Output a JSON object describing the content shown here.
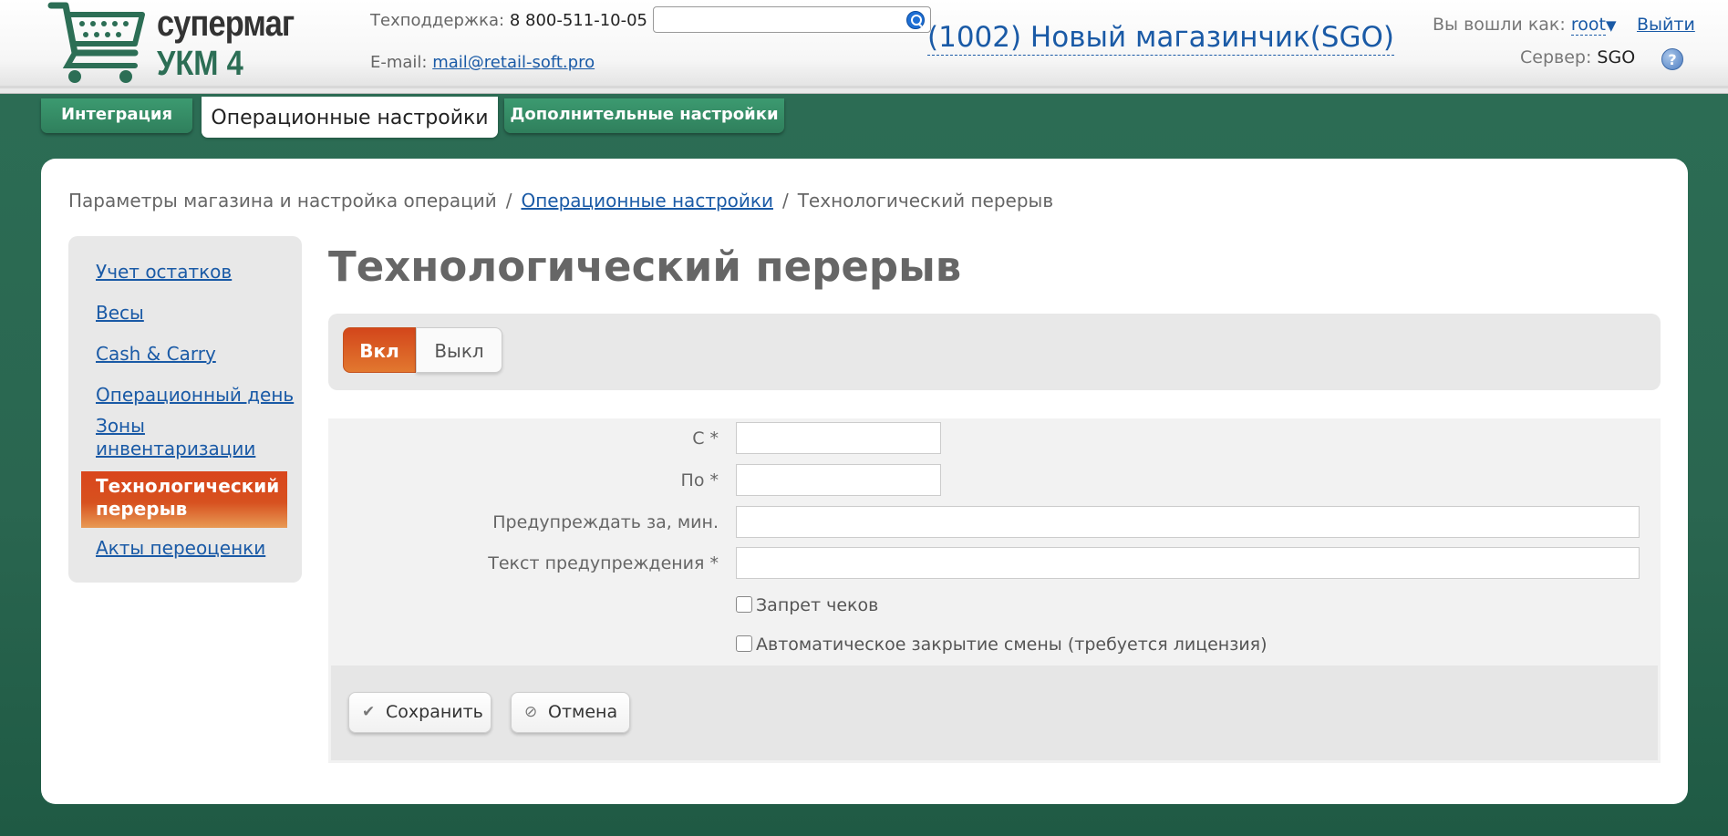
{
  "header": {
    "logo_line1": "супермаг",
    "logo_line2": "УКМ 4",
    "support_label": "Техподдержка:",
    "support_phone": "8 800-511-10-05",
    "email_label": "E-mail:",
    "email_value": "mail@retail-soft.pro",
    "search_placeholder": "",
    "store_name": "(1002) Новый магазинчик(SGO)",
    "login_label": "Вы вошли как:",
    "login_user": "root",
    "logout": "Выйти",
    "server_label": "Сервер:",
    "server_value": "SGO",
    "help": "?"
  },
  "tabs": [
    {
      "label": "Интеграция"
    },
    {
      "label": "Операционные настройки"
    },
    {
      "label": "Дополнительные настройки"
    }
  ],
  "breadcrumb": {
    "root": "Параметры магазина и настройка операций",
    "sep": "/",
    "link": "Операционные настройки",
    "current": "Технологический перерыв"
  },
  "sidebar": {
    "items": [
      {
        "label": "Учет остатков"
      },
      {
        "label": "Весы"
      },
      {
        "label": "Cash & Carry"
      },
      {
        "label": "Операционный день"
      },
      {
        "label": "Зоны инвентаризации"
      },
      {
        "label": "Технологический перерыв"
      },
      {
        "label": "Акты переоценки"
      }
    ]
  },
  "page_title": "Технологический перерыв",
  "toggle": {
    "on": "Вкл",
    "off": "Выкл",
    "selected": "Вкл"
  },
  "form": {
    "from_label": "С *",
    "from_value": "",
    "to_label": "По *",
    "to_value": "",
    "warn_label": "Предупреждать за, мин.",
    "warn_value": "",
    "text_label": "Текст предупреждения *",
    "text_value": "",
    "check_receipts": "Запрет чеков",
    "check_autoclose": "Автоматическое закрытие смены (требуется лицензия)"
  },
  "buttons": {
    "save": "Сохранить",
    "cancel": "Отмена"
  },
  "colors": {
    "accent": "#d7511f",
    "brand_green": "#2c6e55",
    "link": "#1a5aa6"
  }
}
